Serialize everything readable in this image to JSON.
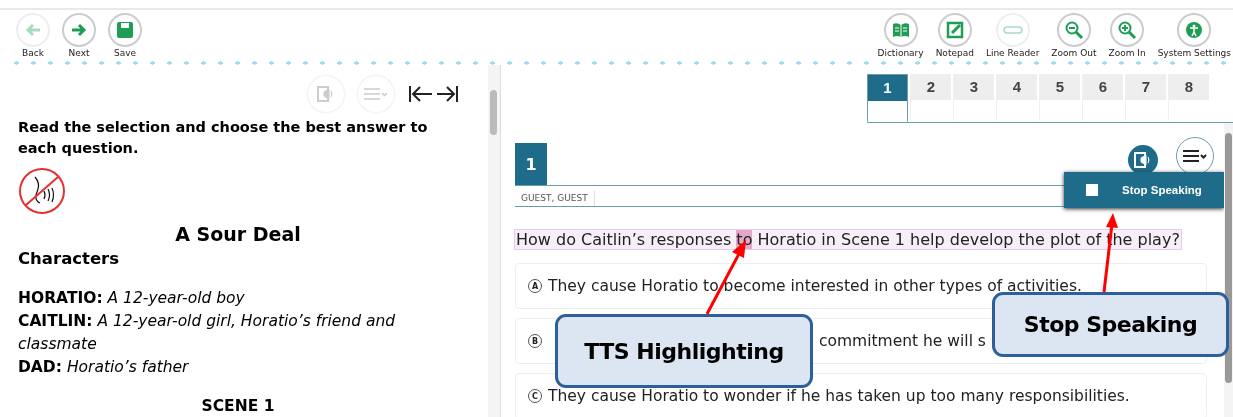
{
  "toolbar": {
    "left": [
      {
        "kind": "back",
        "label": "Back",
        "disabled": true
      },
      {
        "kind": "next",
        "label": "Next",
        "disabled": false
      },
      {
        "kind": "save",
        "label": "Save",
        "disabled": false
      }
    ],
    "right": [
      {
        "kind": "dictionary",
        "label": "Dictionary",
        "disabled": false
      },
      {
        "kind": "notepad",
        "label": "Notepad",
        "disabled": false
      },
      {
        "kind": "linereader",
        "label": "Line Reader",
        "disabled": true
      },
      {
        "kind": "zoomout",
        "label": "Zoom Out",
        "disabled": false
      },
      {
        "kind": "zoomin",
        "label": "Zoom In",
        "disabled": false
      },
      {
        "kind": "settings",
        "label": "System Settings",
        "disabled": false
      }
    ]
  },
  "passage": {
    "instruction": "Read the selection and choose the best answer to each question.",
    "title": "A Sour Deal",
    "characters_heading": "Characters",
    "characters": [
      "**HORATIO:** *A 12-year-old boy*",
      "**CAITLIN:** *A 12-year-old girl, Horatio’s friend and classmate*",
      "**DAD:** *Horatio’s father*"
    ],
    "scene": "SCENE 1"
  },
  "tabs": [
    {
      "label": "1",
      "selected": true
    },
    {
      "label": "2",
      "selected": false
    },
    {
      "label": "3",
      "selected": false
    },
    {
      "label": "4",
      "selected": false
    },
    {
      "label": "5",
      "selected": false
    },
    {
      "label": "6",
      "selected": false
    },
    {
      "label": "7",
      "selected": false
    },
    {
      "label": "8",
      "selected": false
    }
  ],
  "question": {
    "number": "1",
    "student": "GUEST, GUEST",
    "text_before": "How do Caitlin’s responses ",
    "text_highlighted": "to",
    "text_after": " Horatio in Scene 1 help develop the plot of the play?",
    "speaking": true,
    "menu_item": "Stop Speaking",
    "options": [
      {
        "letter": "A",
        "text": "They cause Horatio to become interested in other types of activities."
      },
      {
        "letter": "B",
        "text": "commitment he will s"
      },
      {
        "letter": "C",
        "text": "They cause Horatio to wonder if he has taken up too many responsibilities."
      }
    ]
  },
  "callouts": [
    {
      "text": "TTS Highlighting"
    },
    {
      "text": "Stop Speaking"
    }
  ]
}
